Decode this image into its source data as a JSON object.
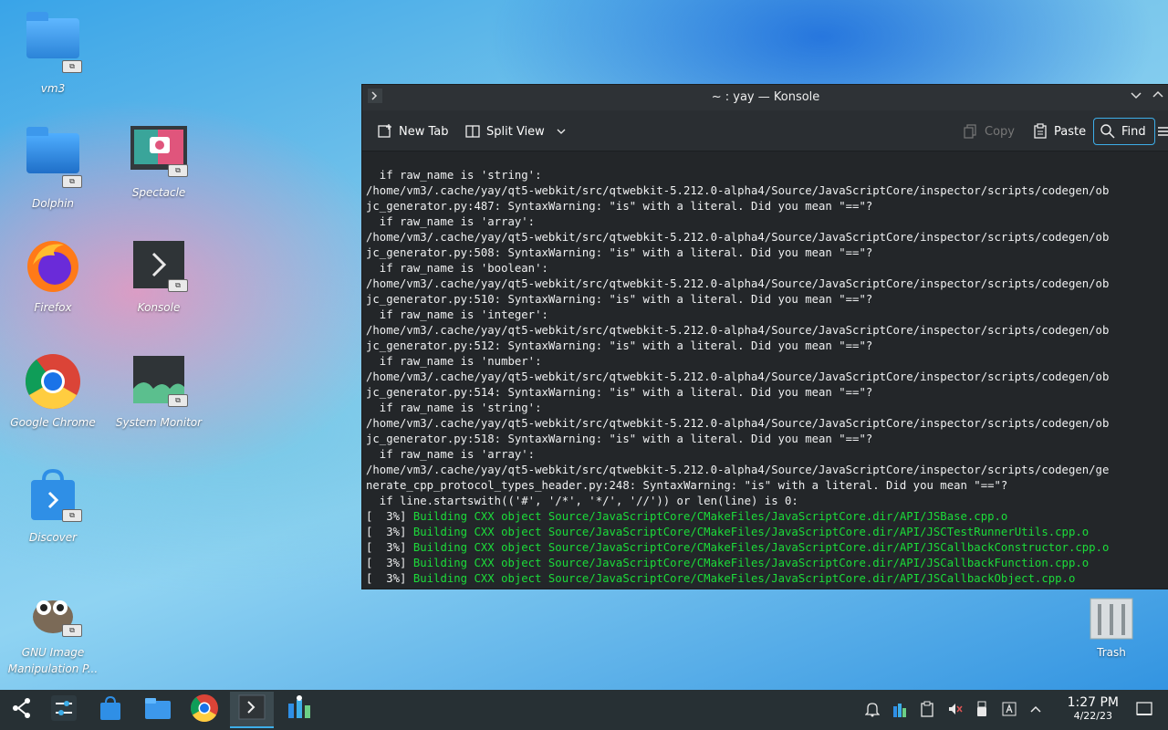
{
  "desktop": {
    "icons": [
      {
        "label": "vm3"
      },
      {
        "label": "Dolphin"
      },
      {
        "label": "Spectacle"
      },
      {
        "label": "Firefox"
      },
      {
        "label": "Konsole"
      },
      {
        "label": "Google Chrome"
      },
      {
        "label": "System Monitor"
      },
      {
        "label": "Discover"
      },
      {
        "label": "GNU Image Manipulation P..."
      },
      {
        "label": "Trash"
      }
    ]
  },
  "window": {
    "title": "~ : yay — Konsole",
    "toolbar": {
      "new_tab": "New Tab",
      "split_view": "Split View",
      "copy": "Copy",
      "paste": "Paste",
      "find": "Find"
    }
  },
  "terminal": {
    "lines": [
      "  if raw_name is 'string':",
      "/home/vm3/.cache/yay/qt5-webkit/src/qtwebkit-5.212.0-alpha4/Source/JavaScriptCore/inspector/scripts/codegen/ob",
      "jc_generator.py:487: SyntaxWarning: \"is\" with a literal. Did you mean \"==\"?",
      "  if raw_name is 'array':",
      "/home/vm3/.cache/yay/qt5-webkit/src/qtwebkit-5.212.0-alpha4/Source/JavaScriptCore/inspector/scripts/codegen/ob",
      "jc_generator.py:508: SyntaxWarning: \"is\" with a literal. Did you mean \"==\"?",
      "  if raw_name is 'boolean':",
      "/home/vm3/.cache/yay/qt5-webkit/src/qtwebkit-5.212.0-alpha4/Source/JavaScriptCore/inspector/scripts/codegen/ob",
      "jc_generator.py:510: SyntaxWarning: \"is\" with a literal. Did you mean \"==\"?",
      "  if raw_name is 'integer':",
      "/home/vm3/.cache/yay/qt5-webkit/src/qtwebkit-5.212.0-alpha4/Source/JavaScriptCore/inspector/scripts/codegen/ob",
      "jc_generator.py:512: SyntaxWarning: \"is\" with a literal. Did you mean \"==\"?",
      "  if raw_name is 'number':",
      "/home/vm3/.cache/yay/qt5-webkit/src/qtwebkit-5.212.0-alpha4/Source/JavaScriptCore/inspector/scripts/codegen/ob",
      "jc_generator.py:514: SyntaxWarning: \"is\" with a literal. Did you mean \"==\"?",
      "  if raw_name is 'string':",
      "/home/vm3/.cache/yay/qt5-webkit/src/qtwebkit-5.212.0-alpha4/Source/JavaScriptCore/inspector/scripts/codegen/ob",
      "jc_generator.py:518: SyntaxWarning: \"is\" with a literal. Did you mean \"==\"?",
      "  if raw_name is 'array':",
      "/home/vm3/.cache/yay/qt5-webkit/src/qtwebkit-5.212.0-alpha4/Source/JavaScriptCore/inspector/scripts/codegen/ge",
      "nerate_cpp_protocol_types_header.py:248: SyntaxWarning: \"is\" with a literal. Did you mean \"==\"?",
      "  if line.startswith(('#', '/*', '*/', '//')) or len(line) is 0:"
    ],
    "build_lines": [
      {
        "prefix": "[  3%] ",
        "text": "Building CXX object Source/JavaScriptCore/CMakeFiles/JavaScriptCore.dir/API/JSBase.cpp.o"
      },
      {
        "prefix": "[  3%] ",
        "text": "Building CXX object Source/JavaScriptCore/CMakeFiles/JavaScriptCore.dir/API/JSCTestRunnerUtils.cpp.o"
      },
      {
        "prefix": "[  3%] ",
        "text": "Building CXX object Source/JavaScriptCore/CMakeFiles/JavaScriptCore.dir/API/JSCallbackConstructor.cpp.o"
      },
      {
        "prefix": "[  3%] ",
        "text": "Building CXX object Source/JavaScriptCore/CMakeFiles/JavaScriptCore.dir/API/JSCallbackFunction.cpp.o"
      },
      {
        "prefix": "[  3%] ",
        "text": "Building CXX object Source/JavaScriptCore/CMakeFiles/JavaScriptCore.dir/API/JSCallbackObject.cpp.o"
      }
    ]
  },
  "taskbar": {
    "clock_time": "1:27 PM",
    "clock_date": "4/22/23"
  },
  "colors": {
    "accent": "#3daee9",
    "build_green": "#1cdc3a",
    "terminal_bg": "#232629"
  }
}
